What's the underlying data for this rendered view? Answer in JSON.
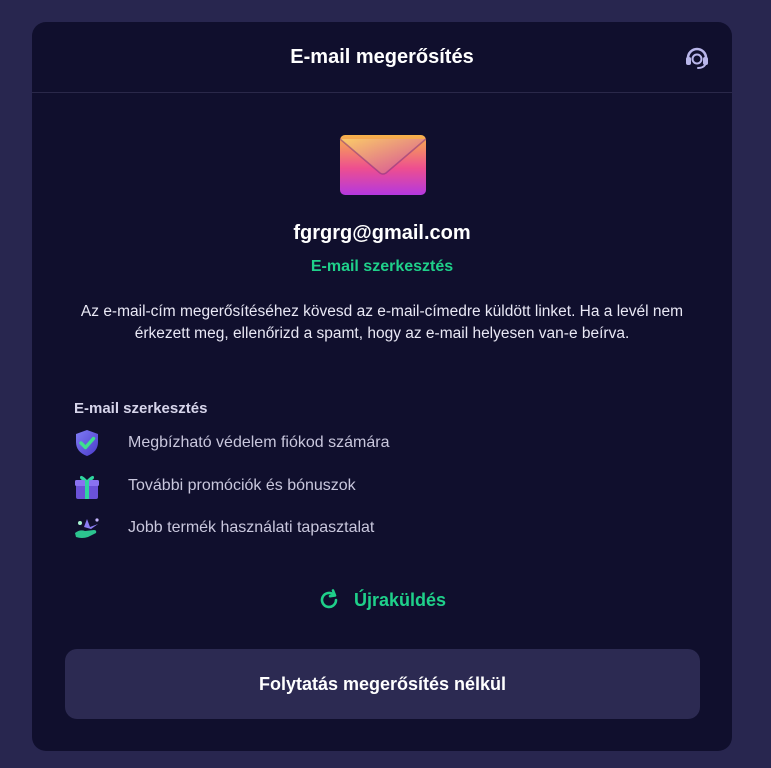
{
  "modal": {
    "title": "E-mail megerősítés",
    "support_icon": "headset-icon"
  },
  "envelope_icon": "envelope-icon",
  "email": "fgrgrg@gmail.com",
  "edit_link": "E-mail szerkesztés",
  "description": "Az e-mail-cím megerősítéséhez kövesd az e-mail-címedre küldött linket. Ha a levél nem érkezett meg, ellenőrizd a spamt, hogy az e-mail helyesen van-e beírva.",
  "benefits": {
    "title": "E-mail szerkesztés",
    "items": [
      {
        "label": "Megbízható védelem fiókod számára",
        "icon": "shield-check-icon"
      },
      {
        "label": "További promóciók és bónuszok",
        "icon": "gift-icon"
      },
      {
        "label": "Jobb termék használati tapasztalat",
        "icon": "hand-sparkle-icon"
      }
    ]
  },
  "resend": {
    "label": "Újraküldés",
    "icon": "refresh-icon"
  },
  "continue_button": "Folytatás megerősítés nélkül",
  "colors": {
    "accent": "#1fd08a",
    "modal_bg": "#100f2d",
    "page_bg": "#28264f",
    "button_bg": "#2c2a52"
  }
}
